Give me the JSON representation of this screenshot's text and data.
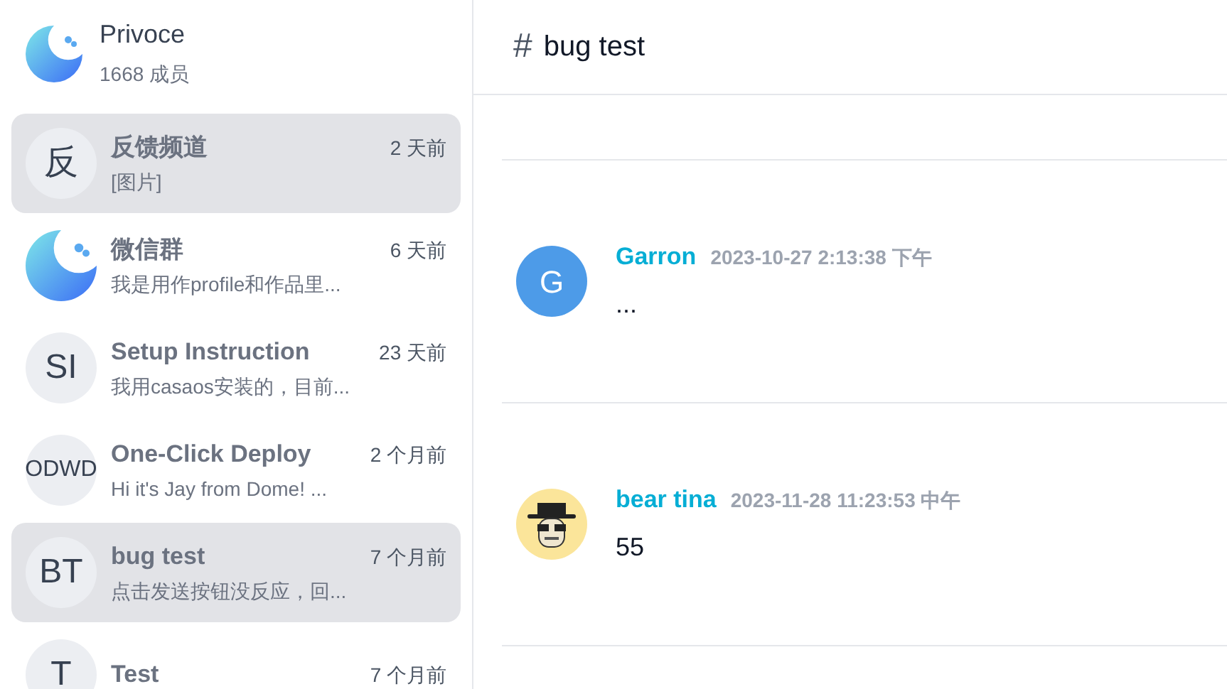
{
  "group": {
    "name": "Privoce",
    "members": "1668 成员"
  },
  "channels": [
    {
      "kind": "initials",
      "avatar_text": "反",
      "name": "反馈频道",
      "time": "2 天前",
      "preview": "[图片]",
      "selected": true
    },
    {
      "kind": "logo",
      "name": "微信群",
      "time": "6 天前",
      "preview": "我是用作profile和作品里...",
      "selected": false
    },
    {
      "kind": "initials",
      "avatar_text": "SI",
      "name": "Setup Instruction",
      "time": "23 天前",
      "preview": "我用casaos安装的，目前...",
      "selected": false
    },
    {
      "kind": "initials",
      "avatar_text": "ODWD",
      "name": "One-Click Deploy",
      "time": "2 个月前",
      "preview": "Hi it's Jay from Dome! ...",
      "selected": false
    },
    {
      "kind": "initials",
      "avatar_text": "BT",
      "name": "bug test",
      "time": "7 个月前",
      "preview": "点击发送按钮没反应，回...",
      "selected": true
    },
    {
      "kind": "initials",
      "avatar_text": "T",
      "name": "Test",
      "time": "7 个月前",
      "selected": false
    }
  ],
  "channel_header": {
    "hash": "#",
    "title": "bug test"
  },
  "messages": [
    {
      "kind": "letter",
      "avatar_text": "G",
      "author": "Garron",
      "time": "2023-10-27 2:13:38 下午",
      "text": "..."
    },
    {
      "kind": "drawing",
      "author": "bear tina",
      "time": "2023-11-28 11:23:53 中午",
      "text": "55"
    }
  ]
}
